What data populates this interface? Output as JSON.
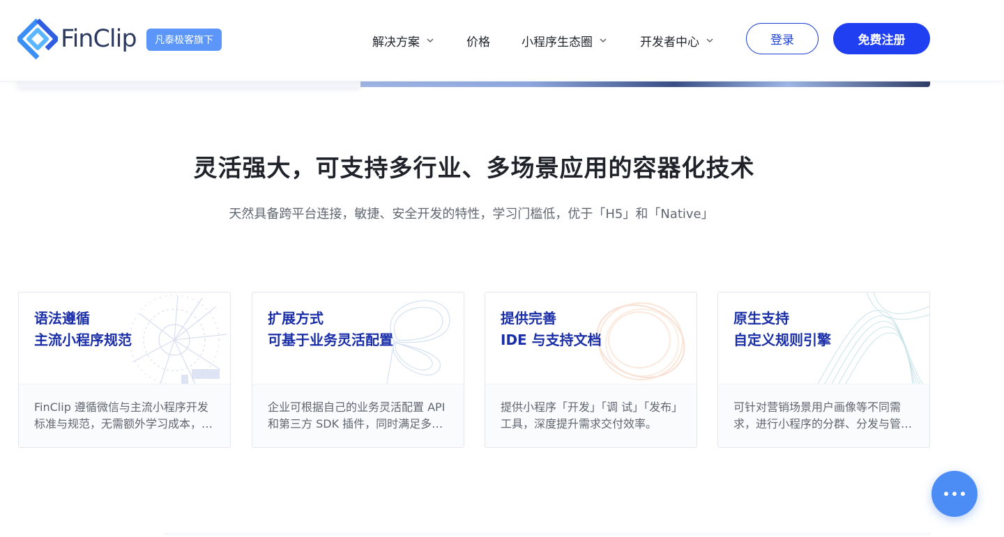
{
  "header": {
    "logo_text": "FinClip",
    "logo_badge": "凡泰极客旗下",
    "nav": [
      {
        "label": "解决方案",
        "has_dropdown": true
      },
      {
        "label": "价格",
        "has_dropdown": false
      },
      {
        "label": "小程序生态圈",
        "has_dropdown": true
      },
      {
        "label": "开发者中心",
        "has_dropdown": true
      }
    ],
    "login_label": "登录",
    "signup_label": "免费注册"
  },
  "section": {
    "title": "灵活强大，可支持多行业、多场景应用的容器化技术",
    "subtitle": "天然具备跨平台连接，敏捷、安全开发的特性，学习门槛低，优于「H5」和「Native」"
  },
  "cards": [
    {
      "title_line1": "语法遵循",
      "title_line2": "主流小程序规范",
      "desc": "FinClip 遵循微信与主流小程序开发标准与规范，无需额外学习成本，即可快速上手开发。"
    },
    {
      "title_line1": "扩展方式",
      "title_line2": "可基于业务灵活配置",
      "desc": "企业可根据自己的业务灵活配置 API 和第三方 SDK 插件，同时满足多样化的业务需求。"
    },
    {
      "title_line1": "提供完善",
      "title_line2": "IDE 与支持文档",
      "desc": "提供小程序「开发」「调 试」「发布」工具，深度提升需求交付效率。"
    },
    {
      "title_line1": "原生支持",
      "title_line2": "自定义规则引擎",
      "desc": "可针对营销场景用户画像等不同需求，进行小程序的分群、分发与管理。"
    }
  ],
  "colors": {
    "brand_blue": "#1f3ff0",
    "card_title": "#1a2ea8",
    "badge_bg": "#5b96f8",
    "fab_bg": "#4c8cf5"
  },
  "icons": {
    "chat": "more-dots-icon",
    "dropdown": "chevron-down-icon"
  }
}
